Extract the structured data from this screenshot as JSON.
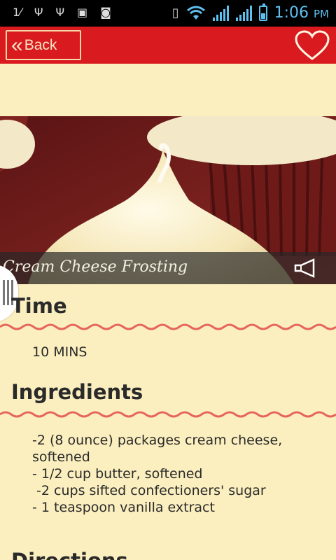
{
  "status_bar": {
    "time": "1:06",
    "ampm": "PM",
    "icons": [
      "signal-strength-1x-icon",
      "usb-icon",
      "usb-debug-icon",
      "gallery-icon",
      "camera-icon",
      "vibrate-icon",
      "wifi-icon",
      "signal-icon",
      "signal-icon-2",
      "battery-charging-icon"
    ]
  },
  "app_bar": {
    "back_label": "Back",
    "favorite_icon": "heart-outline-icon",
    "color": "#d91a1f"
  },
  "hero": {
    "title": "Cream Cheese Frosting",
    "speaker_icon": "megaphone-icon"
  },
  "sections": {
    "time": {
      "heading": "Time",
      "value": "10 MINS"
    },
    "ingredients": {
      "heading": "Ingredients",
      "lines": [
        "-2 (8 ounce) packages cream cheese,",
        "softened",
        "- 1/2 cup butter, softened",
        " -2 cups sifted confectioners' sugar",
        "- 1 teaspoon vanilla extract"
      ]
    },
    "directions": {
      "heading": "Directions"
    }
  },
  "colors": {
    "background": "#fbefbf",
    "accent": "#d91a1f",
    "wave": "#e5655a"
  }
}
